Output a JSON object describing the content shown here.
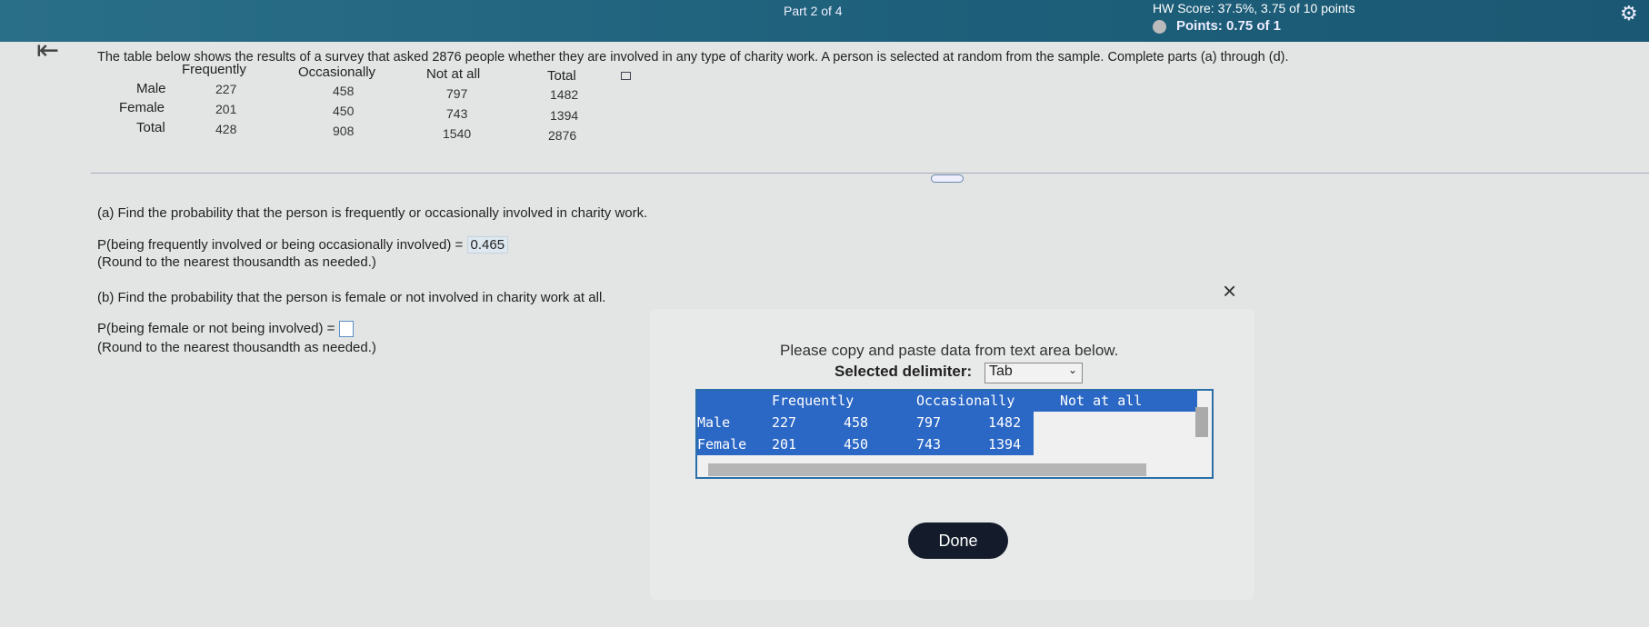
{
  "header": {
    "part": "Part 2 of 4",
    "score": "HW Score: 37.5%, 3.75 of 10 points",
    "points": "Points: 0.75 of 1"
  },
  "intro": "The table below shows the results of a survey that asked 2876 people whether they are involved in any type of charity work. A person is selected at random from the sample. Complete parts (a) through (d).",
  "table": {
    "headers": [
      "Frequently",
      "Occasionally",
      "Not at all",
      "Total"
    ],
    "rows": [
      {
        "label": "Male",
        "values": [
          "227",
          "458",
          "797",
          "1482"
        ]
      },
      {
        "label": "Female",
        "values": [
          "201",
          "450",
          "743",
          "1394"
        ]
      },
      {
        "label": "Total",
        "values": [
          "428",
          "908",
          "1540",
          "2876"
        ]
      }
    ]
  },
  "parts": {
    "a_question": "(a) Find the probability that the person is frequently or occasionally involved in charity work.",
    "a_prompt": "P(being frequently involved or being occasionally involved) =",
    "a_answer": "0.465",
    "a_note": "(Round to the nearest thousandth as needed.)",
    "b_question": "(b) Find the probability that the person is female or not involved in charity work at all.",
    "b_prompt": "P(being female or not being involved) =",
    "b_answer": "",
    "b_note": "(Round to the nearest thousandth as needed.)"
  },
  "popup": {
    "instruction": "Please copy and paste data from text area below.",
    "delimiter_label": "Selected delimiter:",
    "delimiter_value": "Tab",
    "text_header": [
      "Frequently",
      "Occasionally",
      "Not at all"
    ],
    "text_rows": [
      [
        "Male",
        "227",
        "458",
        "797",
        "1482"
      ],
      [
        "Female",
        "201",
        "450",
        "743",
        "1394"
      ]
    ],
    "done": "Done"
  }
}
